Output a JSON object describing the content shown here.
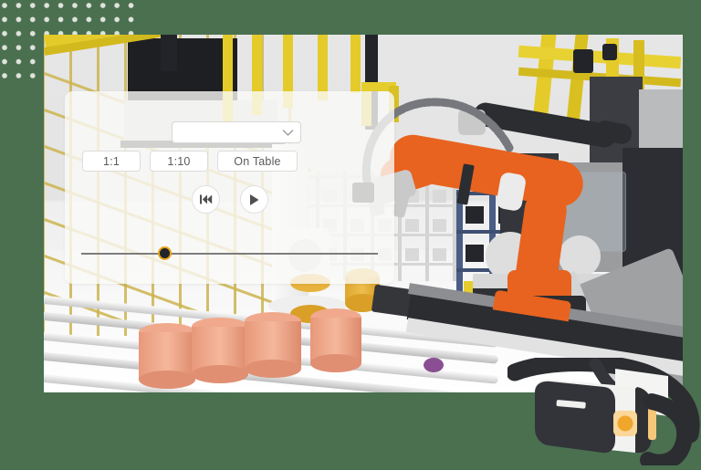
{
  "page": {
    "background_color": "#4a7050",
    "accent_color": "#e8a317"
  },
  "decoration": {
    "dot_grid_name": "dot-grid-pattern",
    "dot_color": "#dfe3dc"
  },
  "scene": {
    "name": "factory-robot-scene",
    "description": "Industrial factory simulation with orange KUKA robot arm, yellow gantry, conveyor with cylindrical parts, blue storage racks and gray CNC machines"
  },
  "control_panel": {
    "dropdown": {
      "name": "scene-select",
      "value": "",
      "placeholder": "",
      "icon": "chevron-down-icon"
    },
    "mode_buttons": [
      {
        "label": "1:1",
        "name": "scale-1-1-button"
      },
      {
        "label": "1:10",
        "name": "scale-1-10-button"
      },
      {
        "label": "On Table",
        "name": "on-table-button"
      }
    ],
    "transport": [
      {
        "name": "skip-to-start-button",
        "icon": "skip-back-icon"
      },
      {
        "name": "play-button",
        "icon": "play-icon"
      }
    ],
    "timeline": {
      "name": "timeline-slider",
      "value_percent": 27,
      "knob_fill": "#22242c",
      "knob_ring": "#e8a317",
      "track_color": "#7d7d7d"
    }
  },
  "vr_headset": {
    "name": "vr-headset-illustration",
    "body_color": "#f2f2f0",
    "face_color": "#33343a",
    "strap_color": "#2c2d31",
    "button_color": "#f0a62a"
  }
}
